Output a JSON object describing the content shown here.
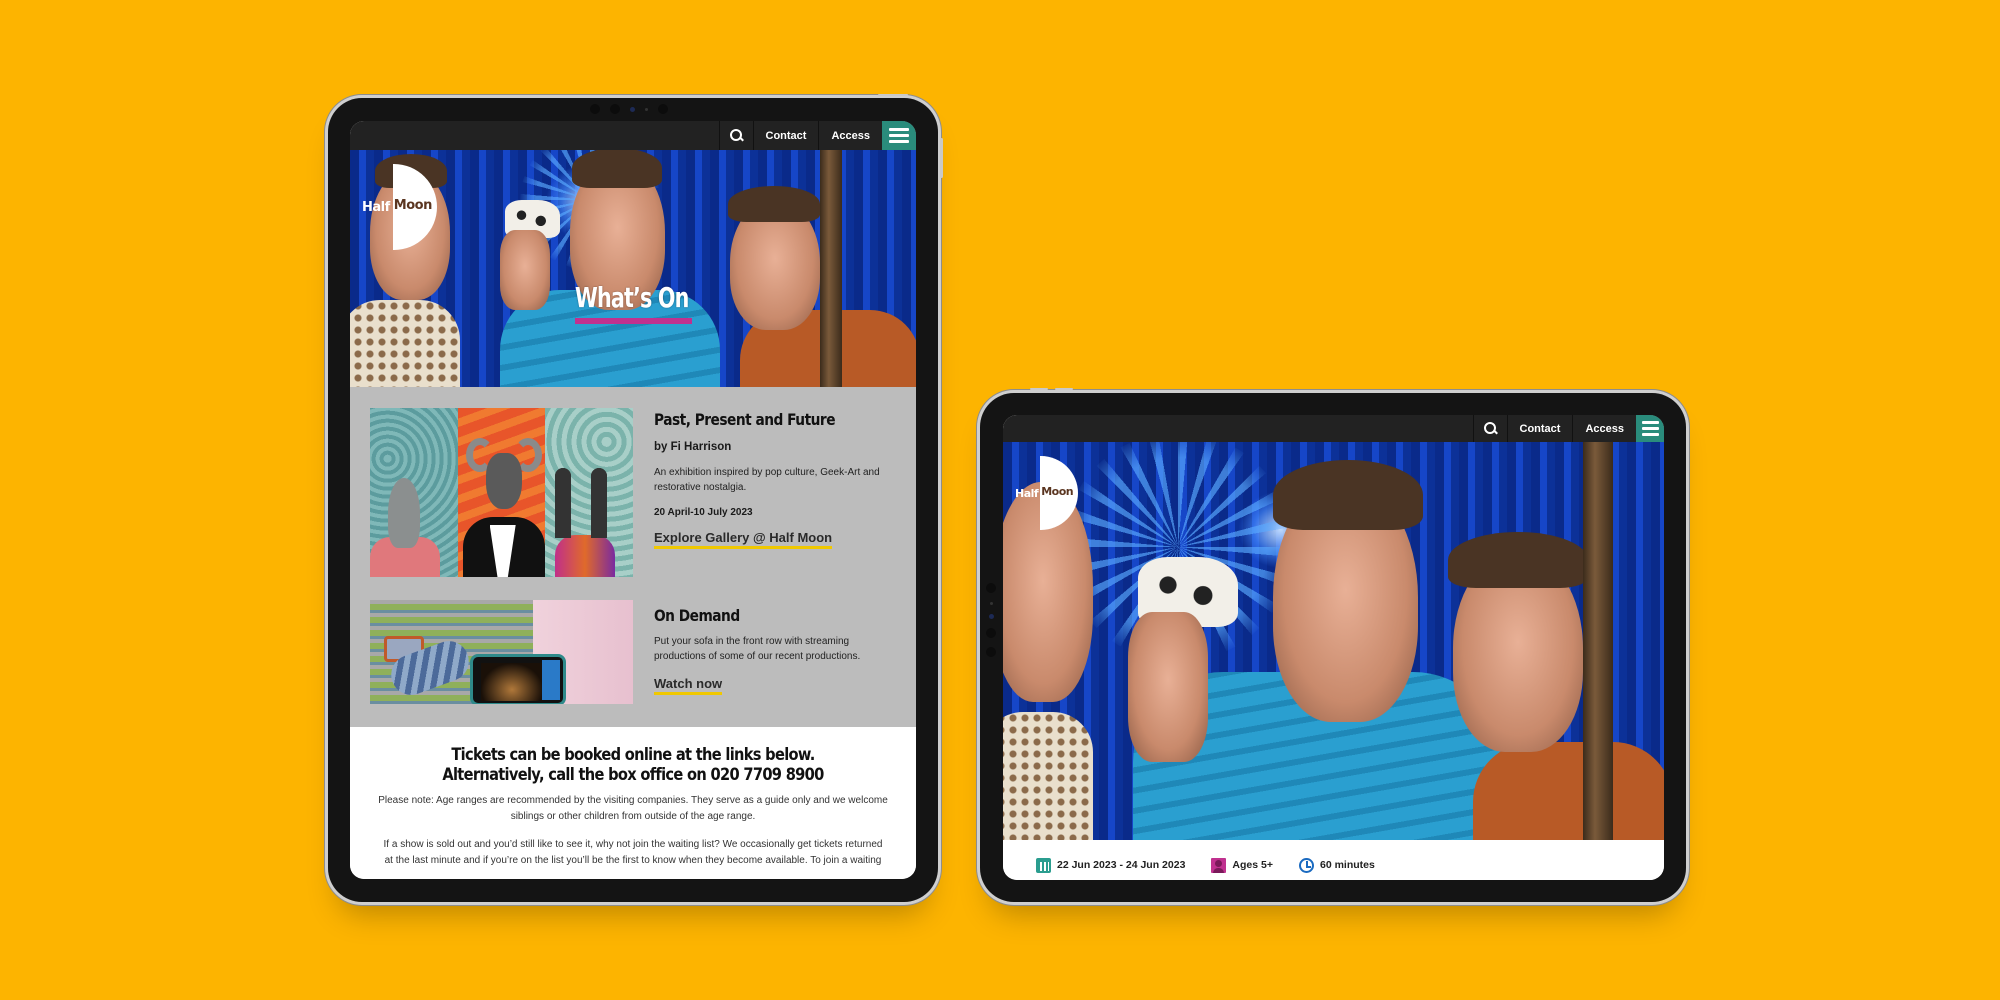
{
  "colors": {
    "background": "#FDB400",
    "menu_accent": "#2a8c7c",
    "title_underline": "#c0318f",
    "link_underline": "#f0c800",
    "promo_bg": "#bcbcbc"
  },
  "topbar": {
    "search_icon": "search-icon",
    "contact_label": "Contact",
    "access_label": "Access",
    "menu_icon": "hamburger-menu-icon"
  },
  "logo": {
    "word1": "Half",
    "word2": "Moon"
  },
  "portrait": {
    "hero_title": "What’s On",
    "cards": [
      {
        "title": "Past, Present and Future",
        "byline": "by Fi Harrison",
        "description": "An exhibition inspired by pop culture, Geek-Art and restorative nostalgia.",
        "dates": "20 April-10 July 2023",
        "cta": "Explore Gallery @ Half Moon"
      },
      {
        "title": "On Demand",
        "description": "Put your sofa in the front row with streaming productions of some of our recent productions.",
        "cta": "Watch now"
      }
    ],
    "tickets": {
      "heading": "Tickets can be booked online at the links below. Alternatively, call the box office on 020 7709 8900",
      "note": "Please note: Age ranges are recommended by the visiting companies. They serve as a guide only and we welcome siblings or other children from outside of the age range.",
      "waiting_list": "If a show is sold out and you’d still like to see it, why not join the waiting list? We occasionally get tickets returned at the last minute and if you’re on the list you’ll be the first to know when they become available. To join a waiting"
    }
  },
  "landscape": {
    "info": {
      "dates": "22 Jun 2023 - 24 Jun 2023",
      "ages": "Ages 5+",
      "duration": "60 minutes"
    }
  }
}
